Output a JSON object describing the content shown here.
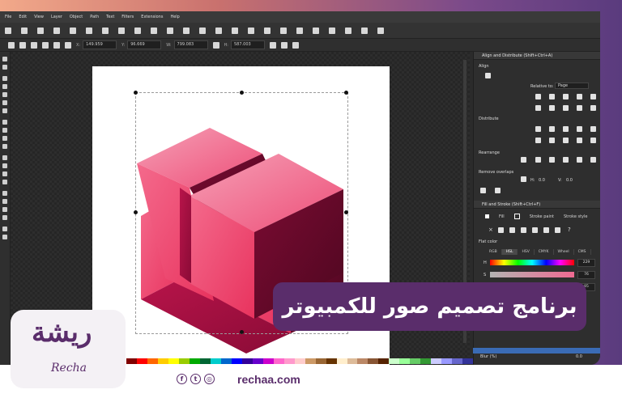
{
  "menu": [
    "File",
    "Edit",
    "View",
    "Layer",
    "Object",
    "Path",
    "Text",
    "Filters",
    "Extensions",
    "Help"
  ],
  "control_bar": {
    "x_label": "X:",
    "x_value": "149.959",
    "y_label": "Y:",
    "y_value": "96.669",
    "w_label": "W:",
    "w_value": "799.083",
    "h_label": "H:",
    "h_value": "587.003"
  },
  "align_panel": {
    "title": "Align and Distribute (Shift+Ctrl+A)",
    "align_label": "Align",
    "relative_label": "Relative to:",
    "relative_value": "Page",
    "distribute_label": "Distribute",
    "rearrange_label": "Rearrange",
    "remove_overlaps_label": "Remove overlaps",
    "h_label": "H:",
    "h_value": "0.0",
    "v_label": "V:",
    "v_value": "0.0"
  },
  "fill_panel": {
    "title": "Fill and Stroke (Shift+Ctrl+F)",
    "tabs": [
      "Fill",
      "Stroke paint",
      "Stroke style"
    ],
    "flat_color_label": "Flat color",
    "color_modes": [
      "RGB",
      "HSL",
      "HSV",
      "CMYK",
      "Wheel",
      "CMS"
    ],
    "active_mode": "HSL",
    "rows": [
      {
        "label": "H",
        "value": "229"
      },
      {
        "label": "S",
        "value": "76"
      },
      {
        "label": "L",
        "value": "85"
      }
    ],
    "blur_label": "Blur (%)",
    "blur_value": "0.0"
  },
  "overlay_title": "برنامج تصميم صور للكمبيوتر",
  "brand": {
    "logo_arabic": "ريشة",
    "logo_latin": "Recha",
    "website": "rechaa.com",
    "social_icons": [
      "facebook-icon",
      "twitter-icon",
      "instagram-icon"
    ]
  },
  "colors": {
    "accent": "#5a2d6b",
    "shape_pink": "#f0567a",
    "shape_dark": "#6e0a2a"
  },
  "palette": [
    "#000000",
    "#1a1a1a",
    "#333333",
    "#4d4d4d",
    "#666666",
    "#808080",
    "#999999",
    "#b3b3b3",
    "#cccccc",
    "#e6e6e6",
    "#ffffff",
    "#800000",
    "#ff0000",
    "#ff6600",
    "#ffcc00",
    "#ffff00",
    "#99cc00",
    "#00aa00",
    "#006633",
    "#00cccc",
    "#0066cc",
    "#0000ff",
    "#330099",
    "#6600cc",
    "#cc00cc",
    "#ff66cc",
    "#ff99cc",
    "#ffcccc",
    "#cc9966",
    "#996633",
    "#663300",
    "#ffeecc",
    "#ddbb99",
    "#bb8866",
    "#885533",
    "#552200",
    "#ccffcc",
    "#99ff99",
    "#66cc66",
    "#339933",
    "#ccccff",
    "#9999ff",
    "#6666cc",
    "#333399"
  ]
}
